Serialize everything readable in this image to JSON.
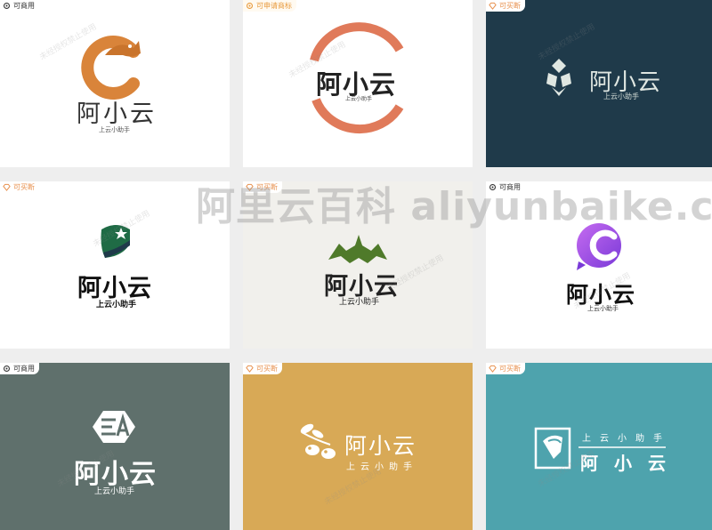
{
  "badges": {
    "commercial": "可商用",
    "apply": "可申请商标",
    "buy": "可买断"
  },
  "brand": {
    "name": "阿小云",
    "slogan": "上云小助手"
  },
  "watermark": {
    "site": "阿里云百科 aliyunbaike.com",
    "repeat": "未经授权禁止使用"
  },
  "colors": {
    "orange": "#d9843a",
    "coral": "#e07a5a",
    "navy": "#1f3a4a",
    "green": "#1f6b45",
    "olive": "#4f7a2a",
    "purple": "#9b4de0",
    "slate": "#5f706c",
    "mustard": "#d8a956",
    "teal": "#4ea3ad"
  },
  "cards": [
    {
      "badge": "commercial",
      "bg": "#ffffff"
    },
    {
      "badge": "apply",
      "bg": "#ffffff"
    },
    {
      "badge": "buy",
      "bg": "#1f3a4a"
    },
    {
      "badge": "buy",
      "bg": "#ffffff"
    },
    {
      "badge": "buy",
      "bg": "#f1f0ec"
    },
    {
      "badge": "commercial",
      "bg": "#ffffff"
    },
    {
      "badge": "commercial",
      "bg": "#5f706c"
    },
    {
      "badge": "buy",
      "bg": "#d8a956"
    },
    {
      "badge": "buy",
      "bg": "#4ea3ad"
    }
  ]
}
